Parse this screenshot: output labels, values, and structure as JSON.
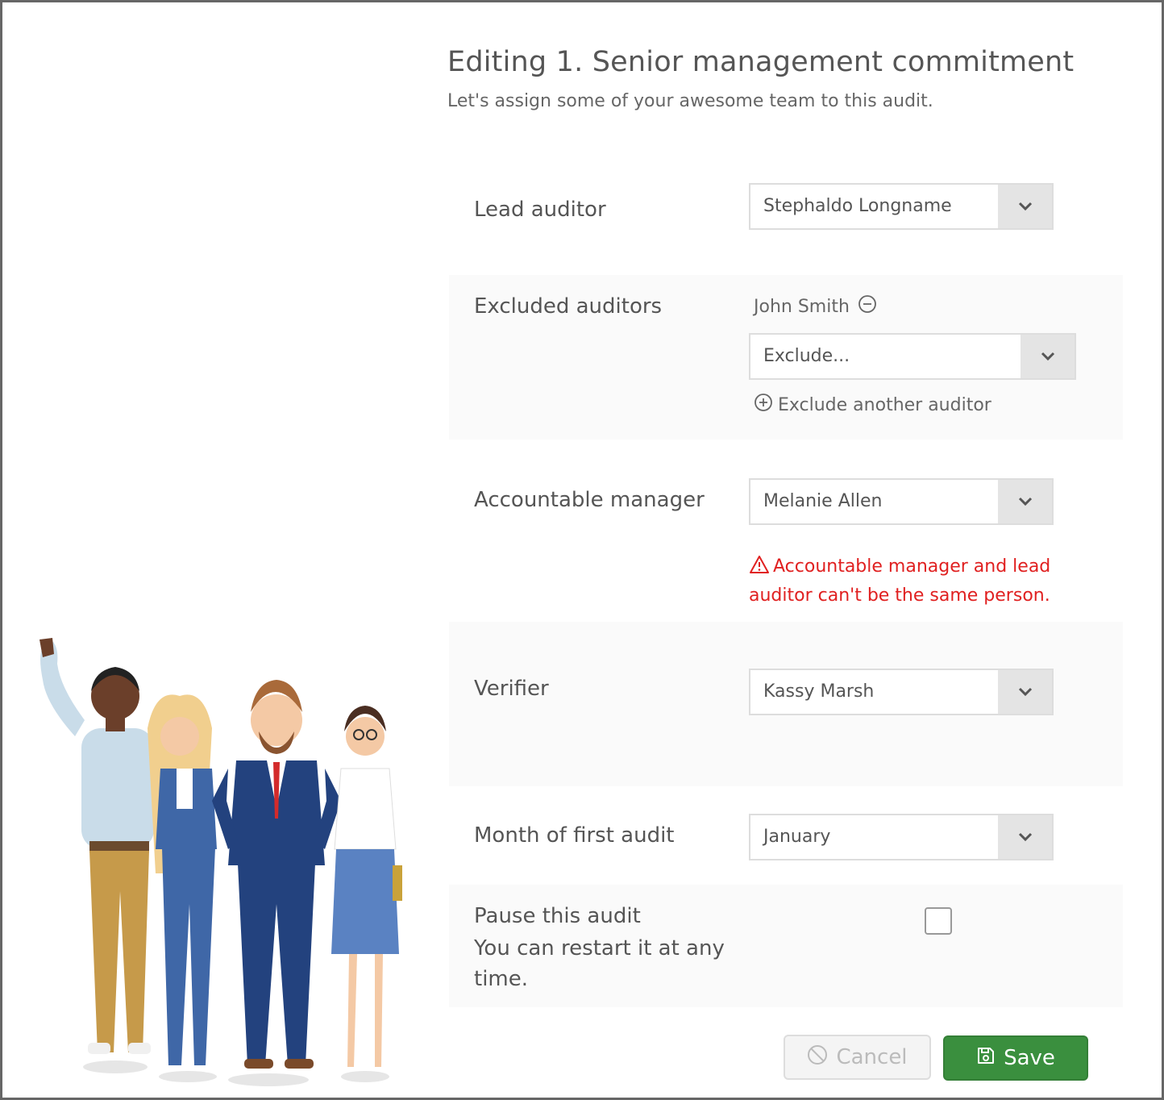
{
  "header": {
    "title": "Editing 1. Senior management commitment",
    "subtitle": "Let's assign some of your awesome team to this audit."
  },
  "lead_auditor": {
    "label": "Lead auditor",
    "value": "Stephaldo Longname"
  },
  "excluded_auditors": {
    "label": "Excluded auditors",
    "tags": [
      "John Smith"
    ],
    "select_value": "Exclude...",
    "add_link": "Exclude another auditor"
  },
  "accountable_manager": {
    "label": "Accountable manager",
    "value": "Melanie Allen",
    "error": "Accountable manager and lead auditor can't be the same person."
  },
  "verifier": {
    "label": "Verifier",
    "value": "Kassy Marsh"
  },
  "first_audit_month": {
    "label": "Month of first audit",
    "value": "January"
  },
  "pause": {
    "label": "Pause this audit",
    "help": "You can restart it at any time.",
    "checked": false
  },
  "buttons": {
    "cancel": "Cancel",
    "save": "Save"
  },
  "icons": {
    "caret": "chevron-down-icon",
    "remove": "minus-circle-icon",
    "add": "plus-circle-icon",
    "warning": "warning-triangle-icon",
    "cancel": "ban-icon",
    "save": "floppy-disk-icon"
  },
  "colors": {
    "error": "#e02020",
    "save_button": "#3a8f3e",
    "cancel_button": "#f4f4f4",
    "shaded_row": "#fafafa"
  }
}
